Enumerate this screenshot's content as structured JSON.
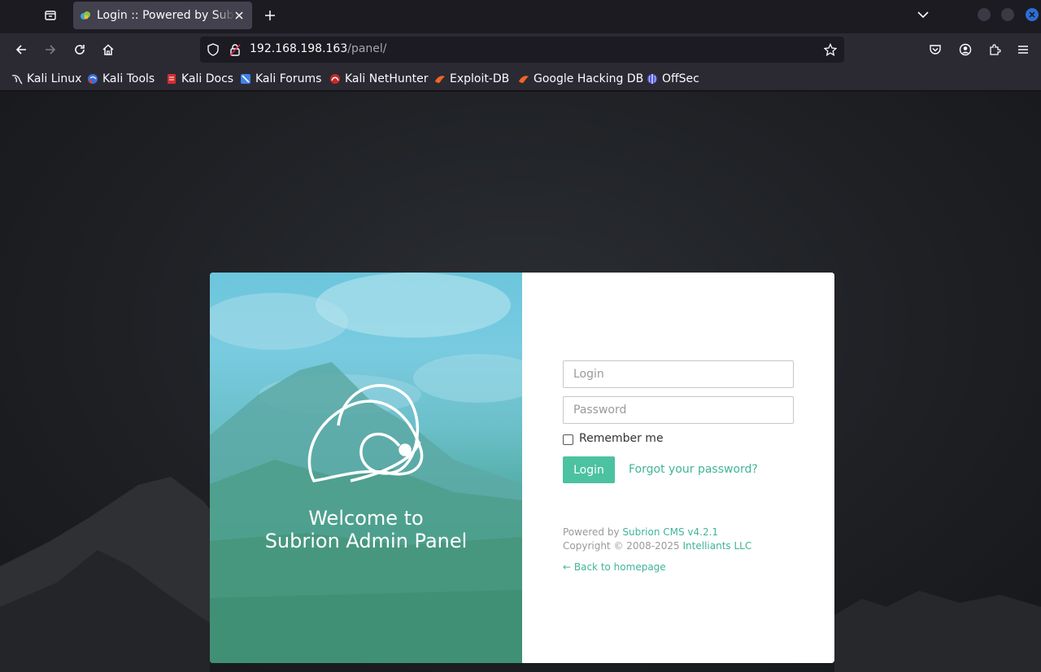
{
  "browser": {
    "tab_title": "Login :: Powered by Subrion",
    "url_host": "192.168.198.163",
    "url_path": "/panel/",
    "bookmarks": [
      {
        "label": "Kali Linux",
        "icon": "kali-dragon-icon"
      },
      {
        "label": "Kali Tools",
        "icon": "kali-tools-icon"
      },
      {
        "label": "Kali Docs",
        "icon": "kali-docs-icon"
      },
      {
        "label": "Kali Forums",
        "icon": "kali-forums-icon"
      },
      {
        "label": "Kali NetHunter",
        "icon": "kali-nethunter-icon"
      },
      {
        "label": "Exploit-DB",
        "icon": "exploit-db-icon"
      },
      {
        "label": "Google Hacking DB",
        "icon": "ghdb-icon"
      },
      {
        "label": "OffSec",
        "icon": "offsec-icon"
      }
    ]
  },
  "panel": {
    "welcome_line1": "Welcome to",
    "welcome_line2": "Subrion Admin Panel",
    "login_placeholder": "Login",
    "password_placeholder": "Password",
    "remember_label": "Remember me",
    "login_button": "Login",
    "forgot_link": "Forgot your password?",
    "powered_prefix": "Powered by ",
    "powered_link": "Subrion CMS v4.2.1",
    "copyright_prefix": "Copyright © 2008-2025 ",
    "copyright_link": "Intelliants LLC",
    "back_link": "← Back to homepage"
  },
  "colors": {
    "accent": "#40b596",
    "button": "#4cc2a0",
    "browser_bg": "#1c1b22",
    "toolbar_bg": "#2b2a33"
  }
}
